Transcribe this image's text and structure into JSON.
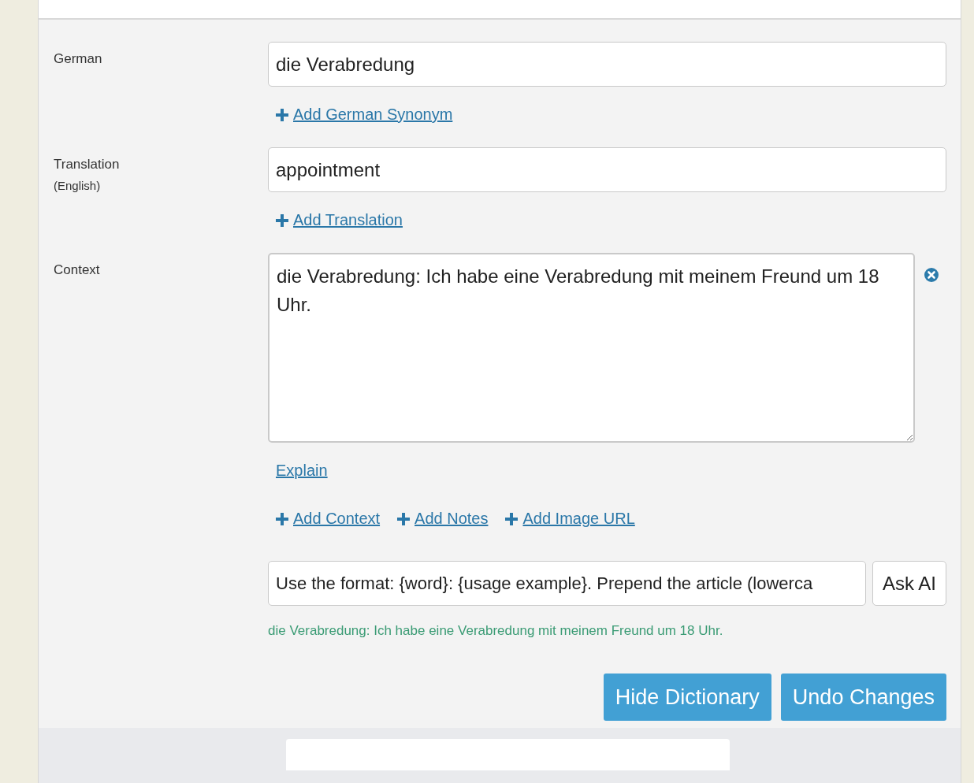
{
  "rows": [
    {
      "kind": "input",
      "label": "German",
      "value": "die Verabredung",
      "links": [
        {
          "text": "Add German Synonym",
          "plus": true
        }
      ]
    },
    {
      "kind": "input",
      "label": "Translation",
      "sublabel": "(English)",
      "value": "appointment",
      "links": [
        {
          "text": "Add Translation",
          "plus": true
        }
      ]
    },
    {
      "kind": "textarea",
      "label": "Context",
      "value": "die Verabredung: Ich habe eine Verabredung mit meinem Freund um 18 Uhr.",
      "removable": true,
      "links": [
        {
          "text": "Explain",
          "plus": false
        }
      ]
    }
  ],
  "add_links": [
    {
      "text": "Add Context",
      "plus": true
    },
    {
      "text": "Add Notes",
      "plus": true
    },
    {
      "text": "Add Image URL",
      "plus": true
    }
  ],
  "ai": {
    "prompt": "Use the format: {word}: {usage example}. Prepend the article (lowerca",
    "button": "Ask AI",
    "result": "die Verabredung: Ich habe eine Verabredung mit meinem Freund um 18 Uhr."
  },
  "buttons": [
    "Hide Dictionary",
    "Undo Changes"
  ]
}
